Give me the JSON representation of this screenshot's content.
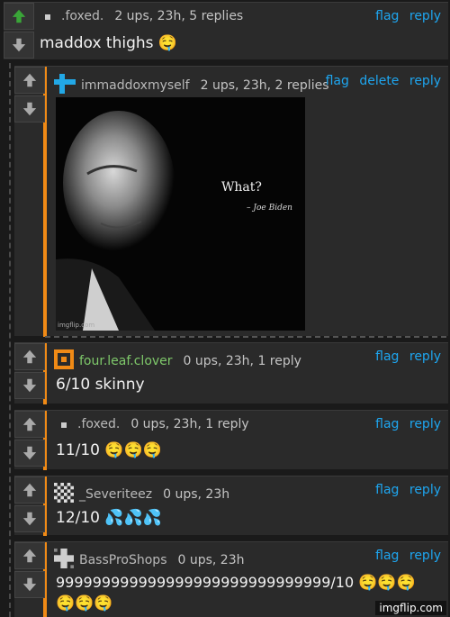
{
  "colors": {
    "accent_orange": "#f08a16",
    "link_blue": "#1ea6f0",
    "upvote_green": "#3aa538",
    "username_green": "#7ec86a"
  },
  "comments": [
    {
      "user": ".foxed.",
      "stats": "2 ups, 23h, 5 replies",
      "actions": [
        "flag",
        "reply"
      ],
      "text": "maddox thighs",
      "emoji": "🤤",
      "avatar": "small-square-icon",
      "upvoted": true
    },
    {
      "user": "immaddoxmyself",
      "stats": "2 ups, 23h, 2 replies",
      "actions": [
        "flag",
        "delete",
        "reply"
      ],
      "text": "",
      "avatar": "blue-pixel-avatar-icon",
      "upvoted": false,
      "image": {
        "quote": "What?",
        "attribution": "– Joe Biden",
        "watermark": "imgflip.com"
      }
    },
    {
      "user": "four.leaf.clover",
      "stats": "0 ups, 23h, 1 reply",
      "actions": [
        "flag",
        "reply"
      ],
      "text": "6/10 skinny",
      "avatar": "orange-square-avatar-icon",
      "upvoted": false
    },
    {
      "user": ".foxed.",
      "stats": "0 ups, 23h, 1 reply",
      "actions": [
        "flag",
        "reply"
      ],
      "text": "11/10",
      "emoji": "🤤🤤🤤",
      "avatar": "small-square-icon",
      "upvoted": false
    },
    {
      "user": "_Severiteez",
      "stats": "0 ups, 23h",
      "actions": [
        "flag",
        "reply"
      ],
      "text": "12/10",
      "emoji": "💦💦💦",
      "avatar": "checker-avatar-icon",
      "upvoted": false
    },
    {
      "user": "BassProShops",
      "stats": "0 ups, 23h",
      "actions": [
        "flag",
        "reply"
      ],
      "text": "999999999999999999999999999999/10",
      "emoji": "🤤🤤🤤",
      "emoji_line2": "🤤🤤🤤",
      "avatar": "gray-pixel-avatar-icon",
      "upvoted": false
    }
  ],
  "site_watermark": "imgflip.com"
}
